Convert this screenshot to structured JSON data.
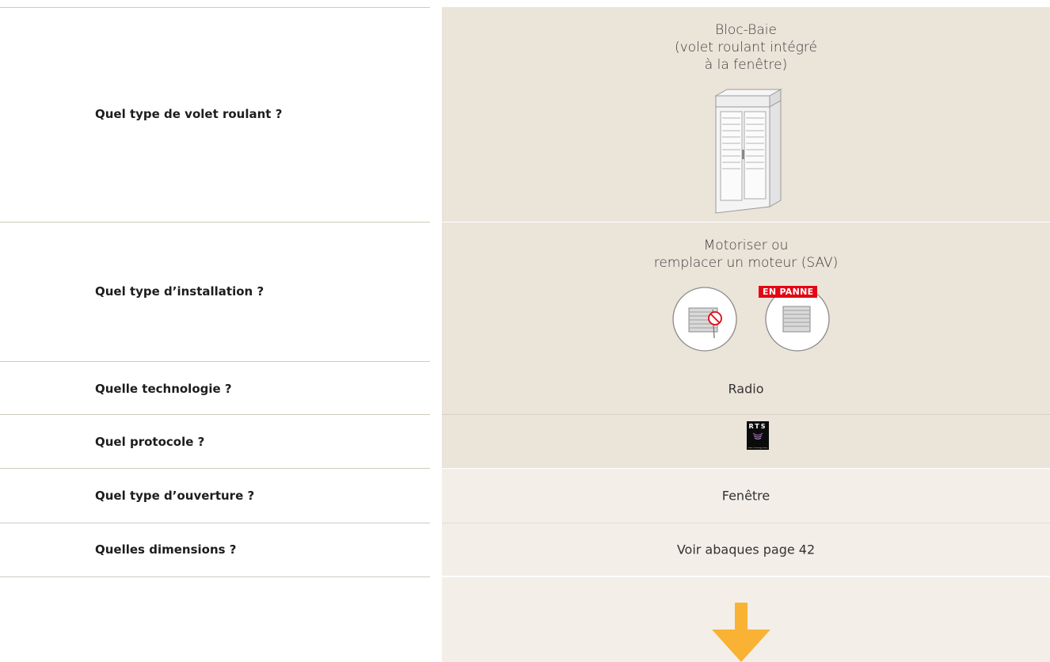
{
  "questions": [
    "Quel type de volet roulant ?",
    "Quel type d’installation ?",
    "Quelle technologie ?",
    "Quel protocole ?",
    "Quel type d’ouverture ?",
    "Quelles dimensions ?"
  ],
  "answers": {
    "volet": [
      "Bloc-Baie",
      "(volet roulant intégré",
      "à la fenêtre)"
    ],
    "installation": [
      "Motoriser ou",
      "remplacer un moteur (SAV)"
    ],
    "installation_badge": "EN PANNE",
    "technologie": "Radio",
    "protocole_logo_text": "RTS",
    "protocole_logo_caption": "Radio Technology Somfy",
    "ouverture": "Fenêtre",
    "dimensions": "Voir abaques page 42"
  },
  "colors": {
    "cell_dark": "#ebe4d9",
    "cell_light": "#f3efe8",
    "badge": "#e30613",
    "arrow": "#f9b233"
  },
  "icons": [
    "bloc-baie-window-icon",
    "motorize-icon",
    "broken-motor-icon",
    "rts-logo",
    "down-arrow-icon"
  ]
}
